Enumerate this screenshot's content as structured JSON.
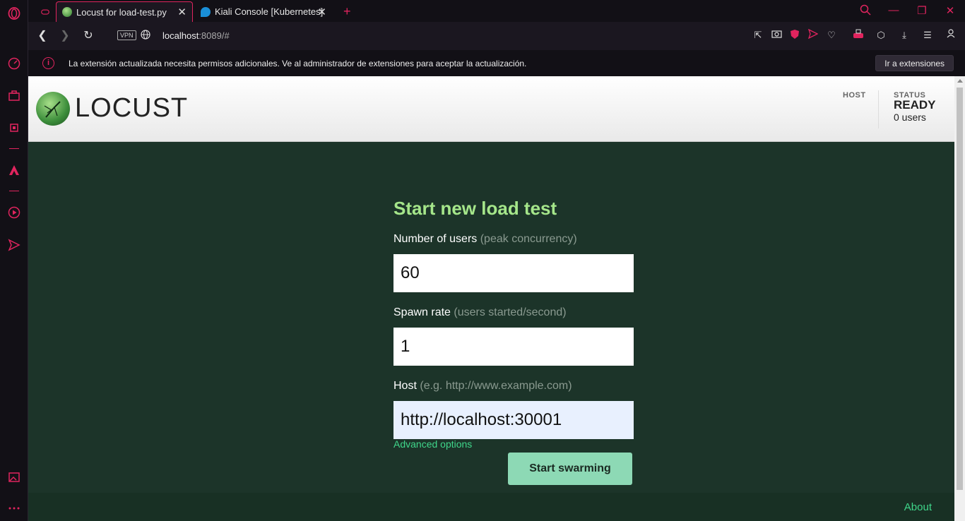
{
  "browser": {
    "tabs": [
      {
        "label": "Locust for load-test.py",
        "active": true
      },
      {
        "label": "Kiali Console [Kubernetes]",
        "active": false
      }
    ],
    "address": {
      "host": "localhost",
      "rest": ":8089/#"
    },
    "vpn_label": "VPN",
    "notice": {
      "message": "La extensión actualizada necesita permisos adicionales. Ve al administrador de extensiones para aceptar la actualización.",
      "button": "Ir a extensiones",
      "icon": "info-icon"
    },
    "accent_color": "#e0245e"
  },
  "locust": {
    "logo_text": "LOCUST",
    "host_label": "HOST",
    "status_label": "STATUS",
    "status_value": "READY",
    "users": "0 users"
  },
  "form": {
    "title": "Start new load test",
    "users_label": "Number of users",
    "users_hint": "(peak concurrency)",
    "users_value": "60",
    "spawn_label": "Spawn rate",
    "spawn_hint": "(users started/second)",
    "spawn_value": "1",
    "host_label": "Host",
    "host_hint": "(e.g. http://www.example.com)",
    "host_value": "http://localhost:30001",
    "advanced": "Advanced options",
    "start_button": "Start swarming"
  },
  "footer": {
    "about": "About"
  }
}
